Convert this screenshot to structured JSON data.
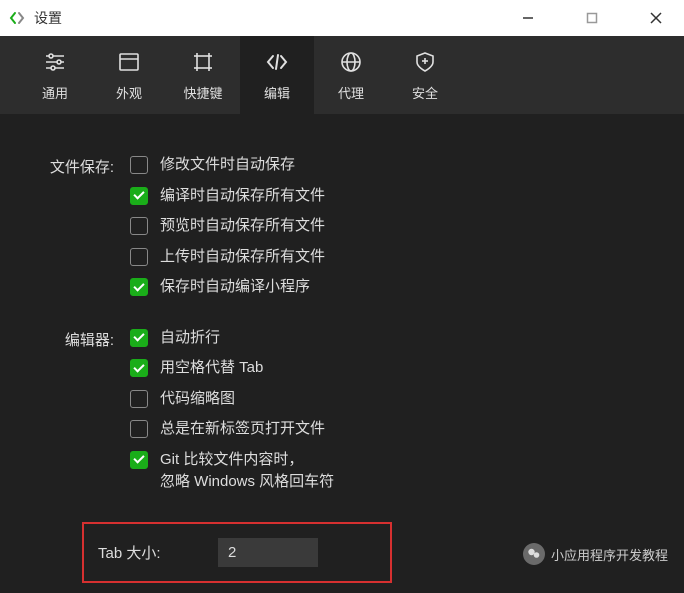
{
  "window": {
    "title": "设置"
  },
  "tabs": [
    {
      "label": "通用"
    },
    {
      "label": "外观"
    },
    {
      "label": "快捷键"
    },
    {
      "label": "编辑"
    },
    {
      "label": "代理"
    },
    {
      "label": "安全"
    }
  ],
  "sections": {
    "fileSave": {
      "label": "文件保存:",
      "options": [
        {
          "label": "修改文件时自动保存",
          "checked": false
        },
        {
          "label": "编译时自动保存所有文件",
          "checked": true
        },
        {
          "label": "预览时自动保存所有文件",
          "checked": false
        },
        {
          "label": "上传时自动保存所有文件",
          "checked": false
        },
        {
          "label": "保存时自动编译小程序",
          "checked": true
        }
      ]
    },
    "editor": {
      "label": "编辑器:",
      "options": [
        {
          "label": "自动折行",
          "checked": true
        },
        {
          "label": "用空格代替 Tab",
          "checked": true
        },
        {
          "label": "代码缩略图",
          "checked": false
        },
        {
          "label": "总是在新标签页打开文件",
          "checked": false
        },
        {
          "label": "Git 比较文件内容时，\n忽略 Windows 风格回车符",
          "checked": true
        }
      ]
    },
    "tabSize": {
      "label": "Tab 大小:",
      "value": "2"
    }
  },
  "watermark": {
    "text": "小应用程序开发教程"
  }
}
